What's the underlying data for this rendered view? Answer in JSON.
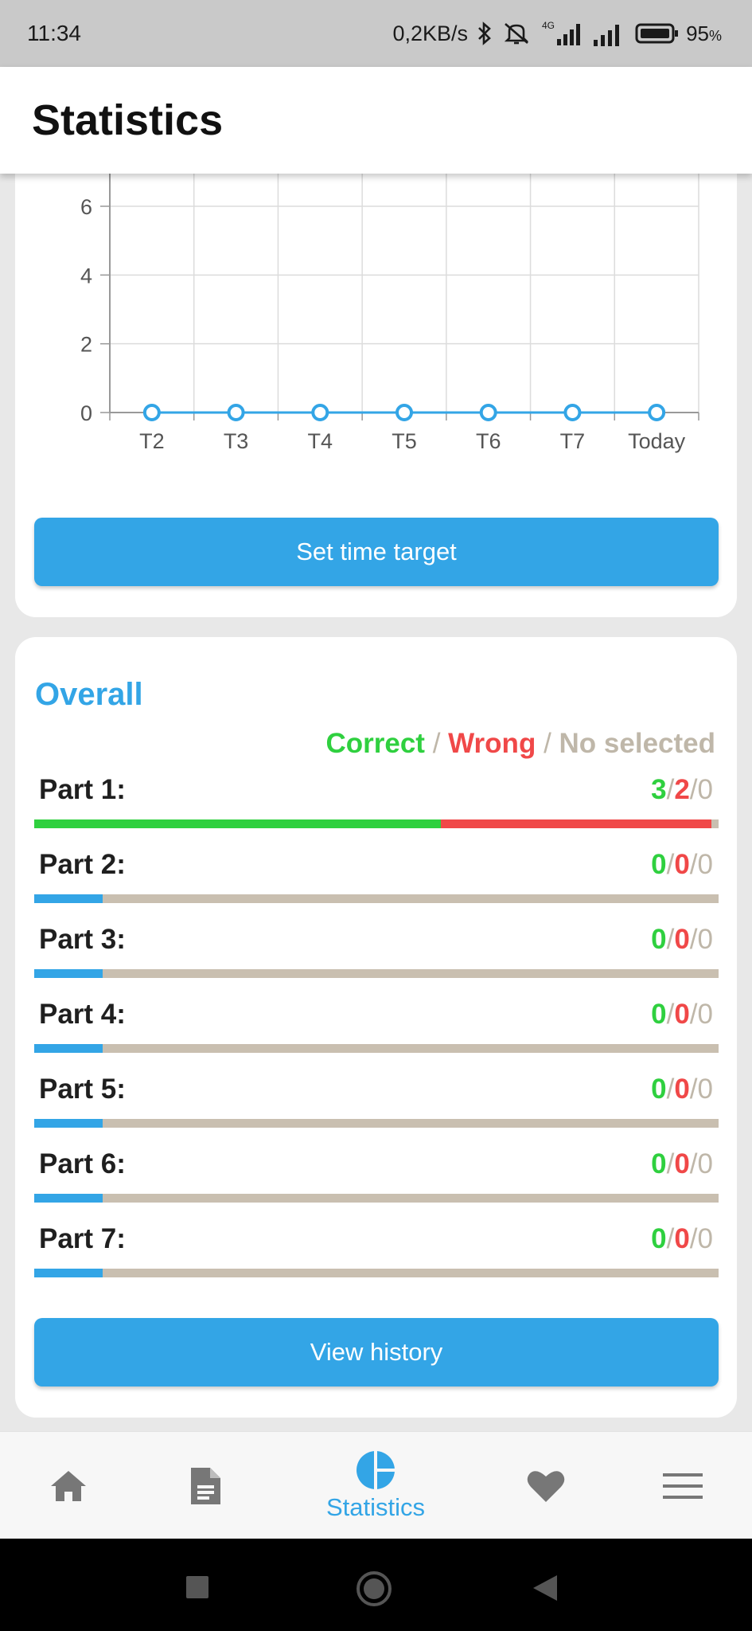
{
  "status_bar": {
    "time": "11:34",
    "network_speed": "0,2KB/s",
    "network_type": "4G",
    "battery_percent": "95",
    "battery_unit": "%",
    "icons": [
      "bluetooth-icon",
      "mute-icon",
      "signal-4g-icon",
      "signal-icon",
      "battery-icon"
    ]
  },
  "header": {
    "title": "Statistics"
  },
  "time_chart": {
    "button_label": "Set time target"
  },
  "chart_data": {
    "type": "line",
    "categories": [
      "T2",
      "T3",
      "T4",
      "T5",
      "T6",
      "T7",
      "Today"
    ],
    "series": [
      {
        "values": [
          0,
          0,
          0,
          0,
          0,
          0,
          0
        ],
        "color": "#33a5e6"
      }
    ],
    "yticks": [
      "0",
      "2",
      "4",
      "6"
    ],
    "ylim": [
      0,
      6
    ],
    "grid": true
  },
  "overall": {
    "title": "Overall",
    "legend": {
      "correct": "Correct",
      "sep": "/",
      "wrong": "Wrong",
      "no_selected": "No selected"
    },
    "parts": [
      {
        "label": "Part 1:",
        "correct": "3",
        "wrong": "2",
        "none": "0",
        "correct_frac": 0.5945,
        "wrong_frac": 0.3945,
        "empty": false
      },
      {
        "label": "Part 2:",
        "correct": "0",
        "wrong": "0",
        "none": "0",
        "correct_frac": 0,
        "wrong_frac": 0,
        "empty": true
      },
      {
        "label": "Part 3:",
        "correct": "0",
        "wrong": "0",
        "none": "0",
        "correct_frac": 0,
        "wrong_frac": 0,
        "empty": true
      },
      {
        "label": "Part 4:",
        "correct": "0",
        "wrong": "0",
        "none": "0",
        "correct_frac": 0,
        "wrong_frac": 0,
        "empty": true
      },
      {
        "label": "Part 5:",
        "correct": "0",
        "wrong": "0",
        "none": "0",
        "correct_frac": 0,
        "wrong_frac": 0,
        "empty": true
      },
      {
        "label": "Part 6:",
        "correct": "0",
        "wrong": "0",
        "none": "0",
        "correct_frac": 0,
        "wrong_frac": 0,
        "empty": true
      },
      {
        "label": "Part 7:",
        "correct": "0",
        "wrong": "0",
        "none": "0",
        "correct_frac": 0,
        "wrong_frac": 0,
        "empty": true
      }
    ],
    "history_button_label": "View history"
  },
  "bottom_nav": {
    "items": [
      {
        "icon": "home-icon",
        "label": ""
      },
      {
        "icon": "document-icon",
        "label": ""
      },
      {
        "icon": "pie-chart-icon",
        "label": "Statistics",
        "active": true
      },
      {
        "icon": "heart-icon",
        "label": ""
      },
      {
        "icon": "menu-icon",
        "label": ""
      }
    ]
  },
  "system_nav": {
    "icons": [
      "recents-icon",
      "home-circle-icon",
      "back-icon"
    ]
  },
  "colors": {
    "accent": "#33a5e6",
    "correct": "#2fd03f",
    "wrong": "#f04848",
    "no_selected": "#bfb7a9"
  }
}
